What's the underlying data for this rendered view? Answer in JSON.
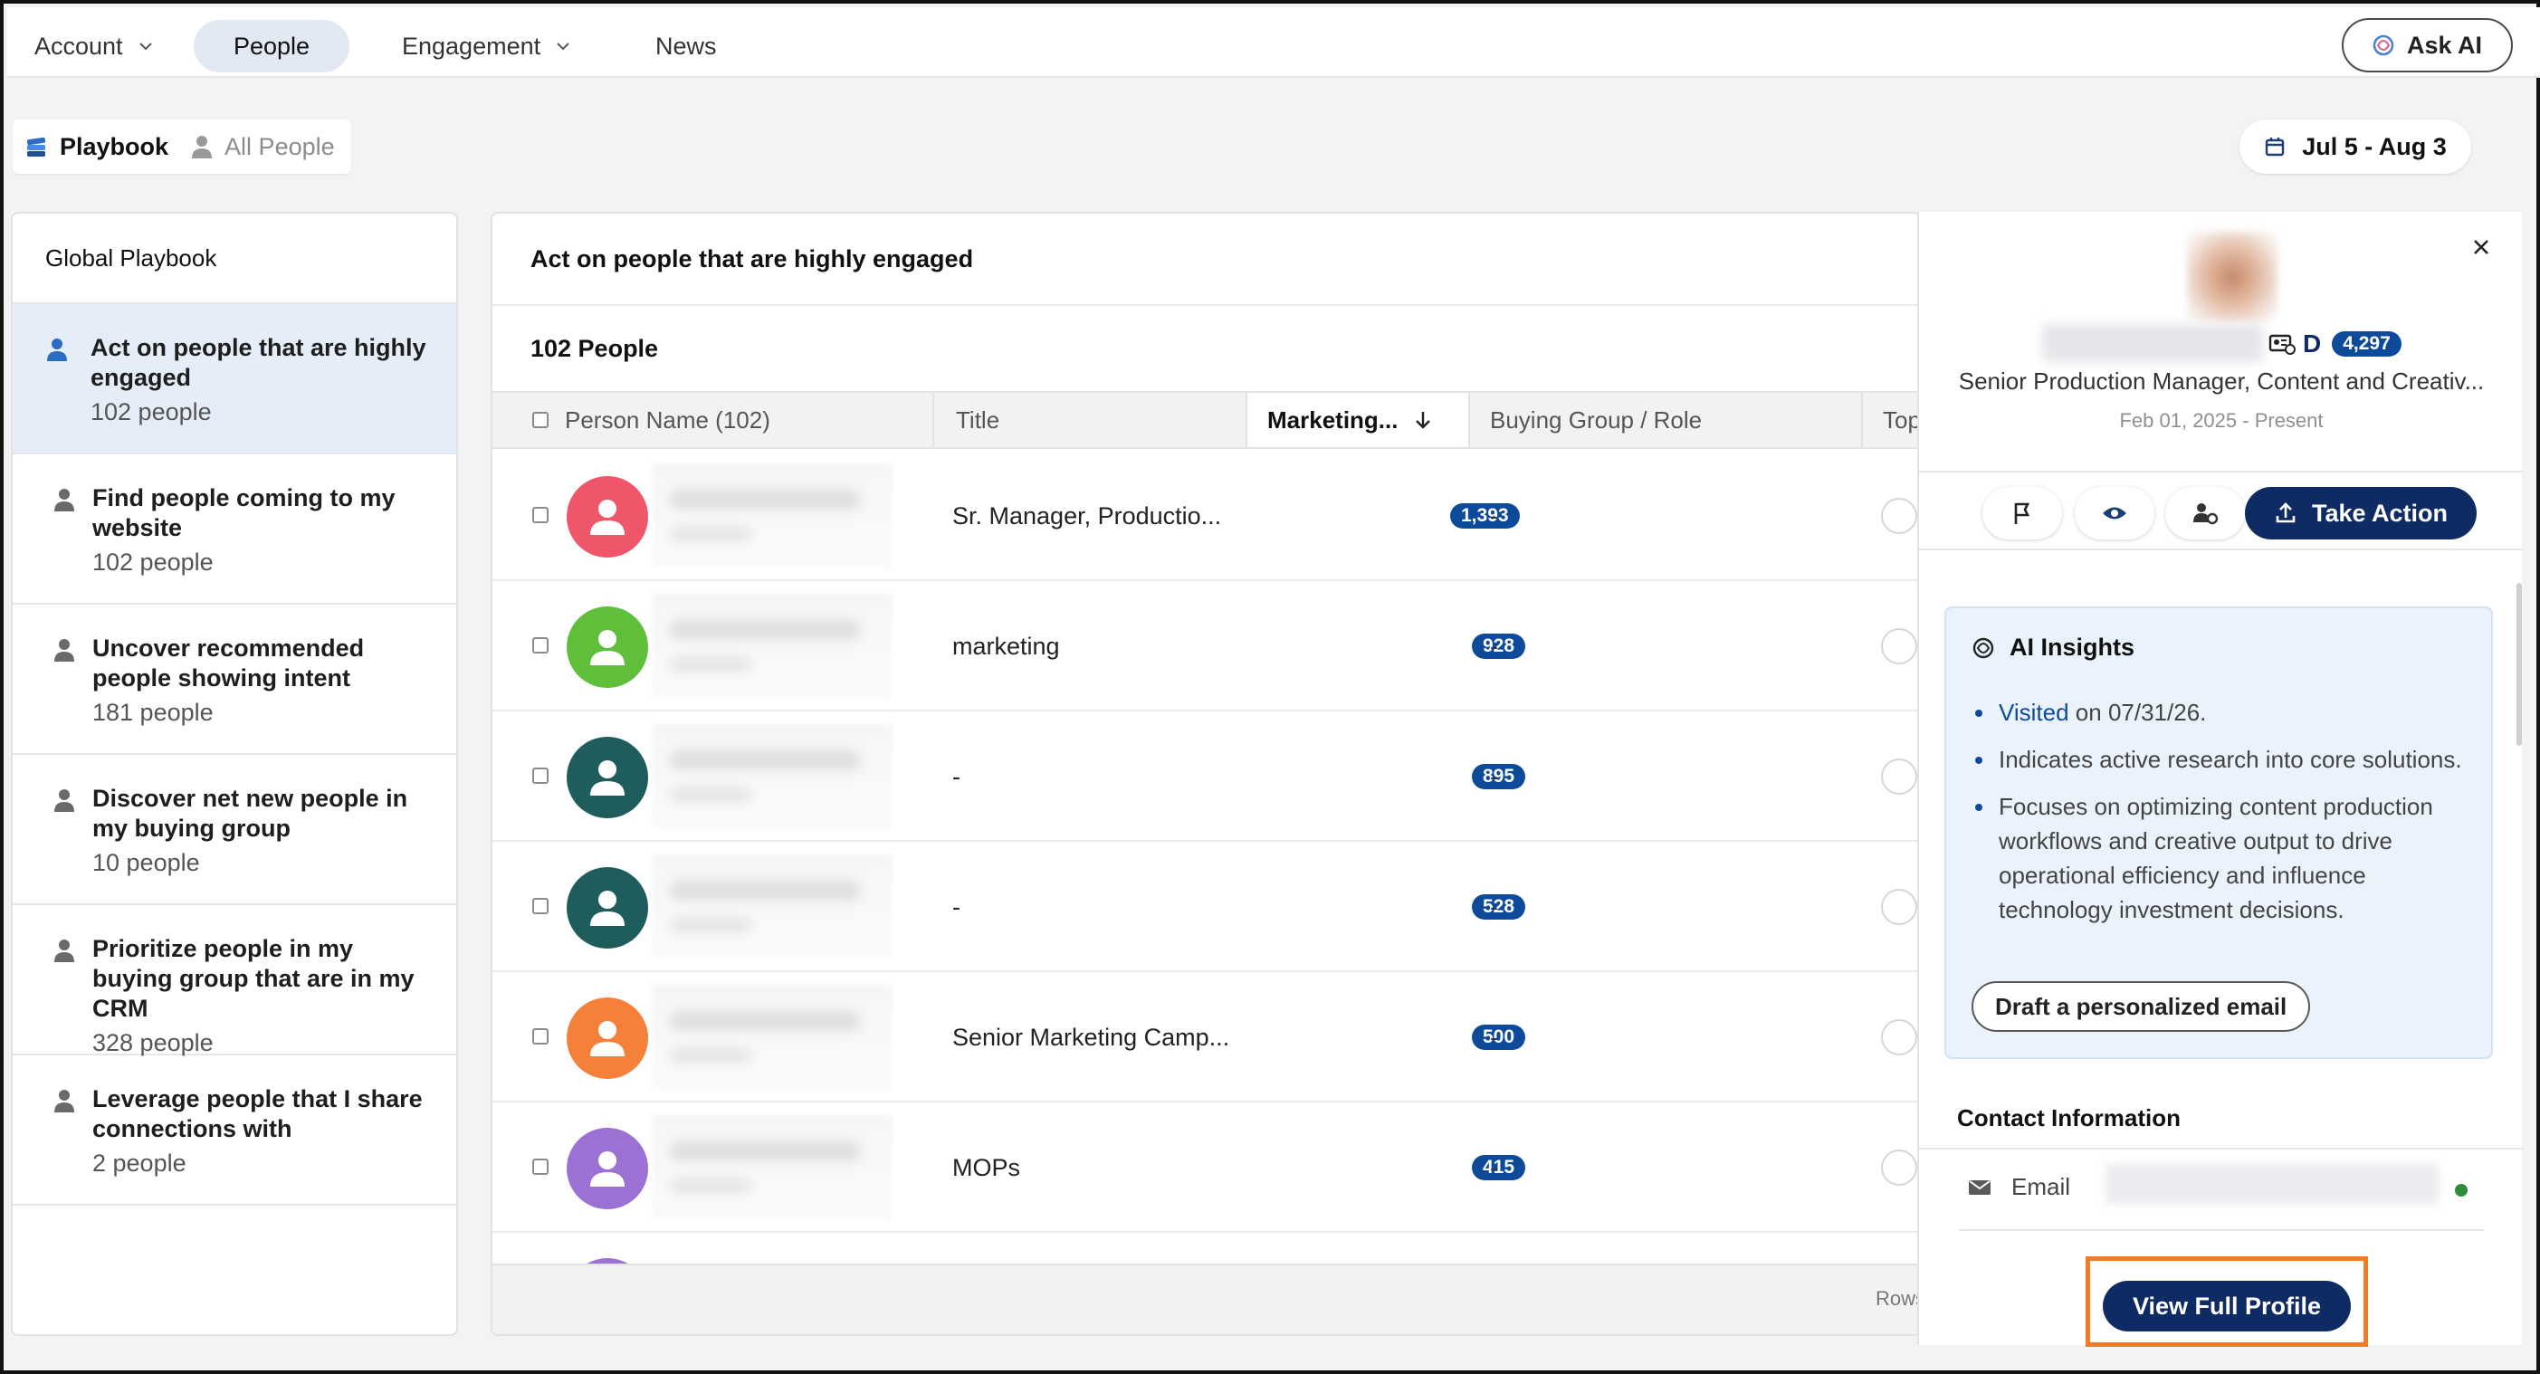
{
  "topnav": {
    "items": [
      {
        "label": "Account",
        "has_menu": true,
        "active": false
      },
      {
        "label": "People",
        "has_menu": false,
        "active": true
      },
      {
        "label": "Engagement",
        "has_menu": true,
        "active": false
      },
      {
        "label": "News",
        "has_menu": false,
        "active": false
      }
    ],
    "ask_ai": "Ask AI"
  },
  "subtabs": {
    "playbook": "Playbook",
    "all_people": "All People"
  },
  "date_range": "Jul 5 - Aug 3",
  "playbook": {
    "title": "Global Playbook",
    "items": [
      {
        "label": "Act on people that are highly engaged",
        "count": "102 people",
        "active": true
      },
      {
        "label": "Find people coming to my website",
        "count": "102 people",
        "active": false
      },
      {
        "label": "Uncover recommended people showing intent",
        "count": "181 people",
        "active": false
      },
      {
        "label": "Discover net new people in my buying group",
        "count": "10 people",
        "active": false
      },
      {
        "label": "Prioritize people in my buying group that are in my CRM",
        "count": "328 people",
        "active": false
      },
      {
        "label": "Leverage people that I share connections with",
        "count": "2 people",
        "active": false
      }
    ]
  },
  "main": {
    "title": "Act on people that are highly engaged",
    "count": "102 People",
    "columns": {
      "person_name": "Person Name (102)",
      "title": "Title",
      "marketing": "Marketing...",
      "buying_group": "Buying Group / Role",
      "top": "Top"
    },
    "rows": [
      {
        "title": "Sr. Manager, Productio...",
        "score": "1,393",
        "buying_group": "-",
        "avatar_color": "#f0566a"
      },
      {
        "title": "marketing",
        "score": "928",
        "buying_group": "-",
        "avatar_color": "#5fbe3a"
      },
      {
        "title": "-",
        "score": "895",
        "buying_group": "-",
        "avatar_color": "#1f5c5c"
      },
      {
        "title": "-",
        "score": "528",
        "buying_group": "-",
        "avatar_color": "#1f5c5c"
      },
      {
        "title": "Senior Marketing Camp...",
        "score": "500",
        "buying_group": "-",
        "avatar_color": "#f4803a"
      },
      {
        "title": "MOPs",
        "score": "415",
        "buying_group": "-",
        "avatar_color": "#9b72d4"
      }
    ],
    "footer": "Rows"
  },
  "profile": {
    "score": "4,297",
    "badge_letter": "D",
    "title": "Senior Production Manager, Content and Creativ...",
    "date": "Feb 01, 2025 - Present",
    "take_action": "Take Action",
    "insights": {
      "heading": "AI Insights",
      "visited_link": "Visited",
      "visited_rest": " on 07/31/26.",
      "bullet2": "Indicates active research into core solutions.",
      "bullet3": "Focuses on optimizing content production workflows and creative output to drive operational efficiency and influence technology investment decisions.",
      "draft_button": "Draft a personalized email"
    },
    "contact_heading": "Contact Information",
    "email_label": "Email",
    "view_full_profile": "View Full Profile"
  },
  "colors": {
    "brand_navy": "#0f2b63",
    "score_blue": "#0d4b9a",
    "highlight_orange": "#f07b22",
    "active_tab_bg": "#e3e9f2",
    "active_item_bg": "#e5eef8"
  }
}
